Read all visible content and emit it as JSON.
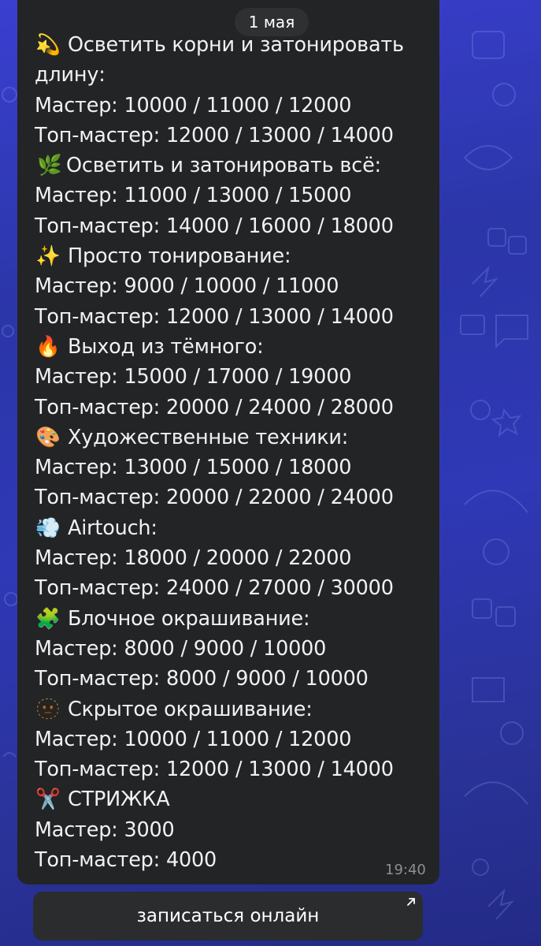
{
  "chat": {
    "date": "1 мая",
    "time": "19:40",
    "online_button": "записаться онлайн"
  },
  "sections": [
    {
      "icon": "dizzy-icon",
      "title_line1": "Осветить корни и затонировать",
      "title_line2": "длину:",
      "master": "Мастер: 10000 / 11000 / 12000",
      "top_master": "Топ-мастер: 12000 / 13000 / 14000"
    },
    {
      "icon": "herb-icon",
      "title": "Осветить и затонировать всё:",
      "master": "Мастер: 11000 / 13000 / 15000",
      "top_master": "Топ-мастер: 14000 / 16000 / 18000"
    },
    {
      "icon": "sparkles-icon",
      "title": "Просто тонирование:",
      "master": "Мастер: 9000 / 10000 / 11000",
      "top_master": "Топ-мастер: 12000 / 13000 / 14000"
    },
    {
      "icon": "fire-icon",
      "title": "Выход из тёмного:",
      "master": "Мастер: 15000 / 17000 / 19000",
      "top_master": "Топ-мастер: 20000 / 24000 / 28000"
    },
    {
      "icon": "palette-icon",
      "title": "Художественные техники:",
      "master": "Мастер: 13000 / 15000 / 18000",
      "top_master": "Топ-мастер: 20000 / 22000 / 24000"
    },
    {
      "icon": "dash-icon",
      "title": "Airtouch:",
      "master": "Мастер: 18000 / 20000 / 22000",
      "top_master": "Топ-мастер: 24000 / 27000 / 30000"
    },
    {
      "icon": "puzzle-icon",
      "title": "Блочное окрашивание:",
      "master": "Мастер: 8000 / 9000 / 10000",
      "top_master": "Топ-мастер: 8000 / 9000 / 10000"
    },
    {
      "icon": "dotted-face-icon",
      "title": "Скрытое окрашивание:",
      "master": "Мастер: 10000 / 11000 / 12000",
      "top_master": "Топ-мастер: 12000 / 13000 / 14000"
    },
    {
      "icon": "scissors-icon",
      "title": "СТРИЖКА",
      "master": "Мастер: 3000",
      "top_master": "Топ-мастер: 4000"
    }
  ],
  "colors": {
    "bubble": "#232426",
    "text": "#f1f1f1",
    "wallpaper": "#2f38b6"
  }
}
